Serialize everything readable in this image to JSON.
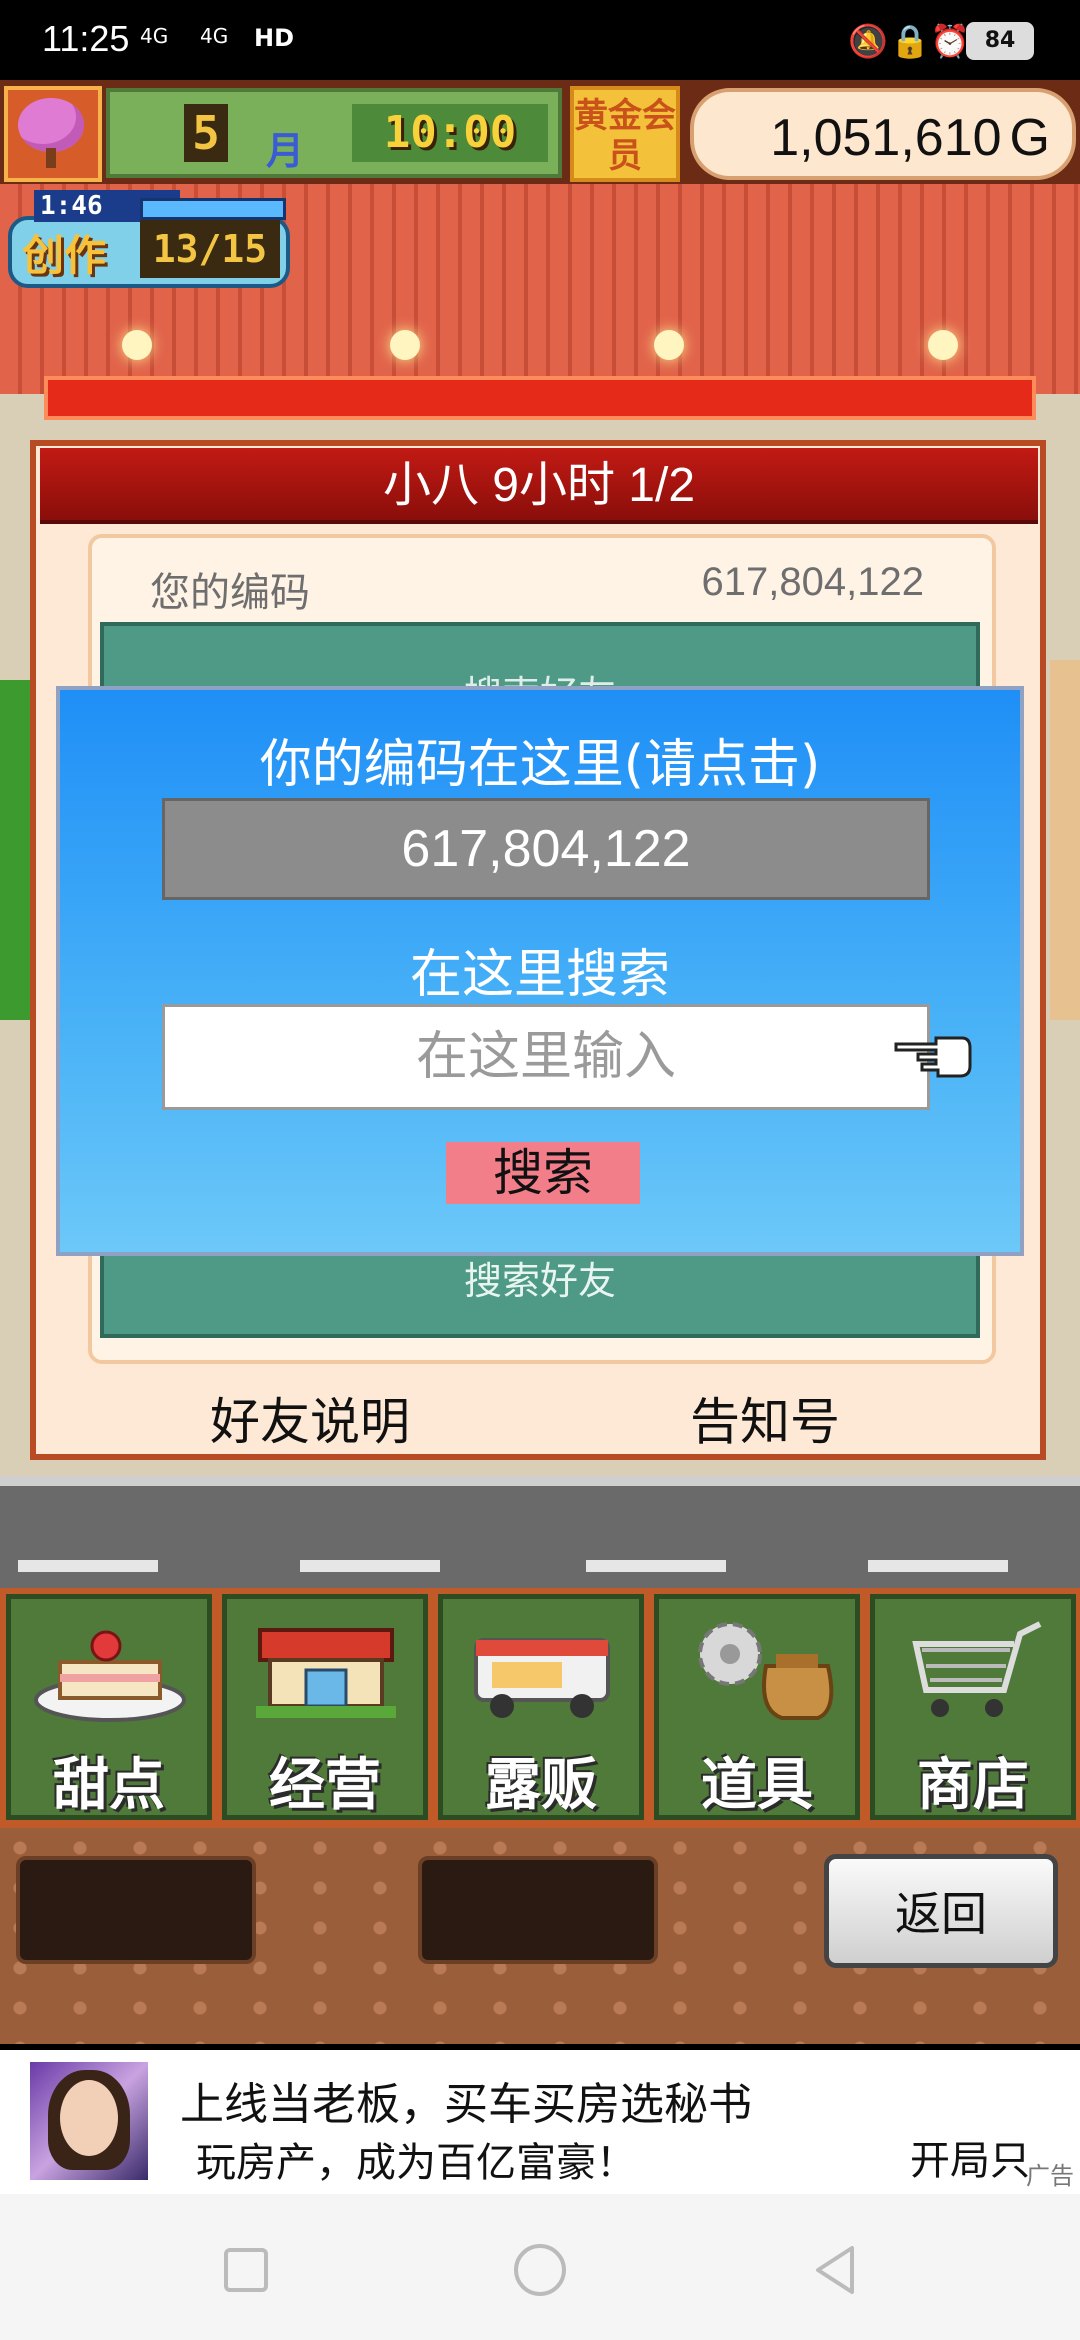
{
  "status_bar": {
    "time": "11:25",
    "signal_1": "4G",
    "signal_2": "4G",
    "hd": "HD",
    "battery": "84"
  },
  "hud": {
    "month_number": "5",
    "month_label": "月",
    "clock": "10:00",
    "gold_member": "黄金会员",
    "money": "1,051,610",
    "currency": "G"
  },
  "create_badge": {
    "timer": "1:46",
    "label": "创作",
    "count": "13/15"
  },
  "panel": {
    "title": "小八  9小时 1/2",
    "your_code_label": "您的编码",
    "your_code_value": "617,804,122",
    "search_friend_top": "搜索好友",
    "search_friend_bottom": "搜索好友",
    "friend_help": "好友说明",
    "notice": "告知号"
  },
  "dialog": {
    "title": "你的编码在这里(请点击)",
    "code": "617,804,122",
    "search_label": "在这里搜索",
    "input_placeholder": "在这里输入",
    "input_value": "",
    "search_button": "搜索"
  },
  "menu": [
    {
      "label": "甜点",
      "icon": "cake-icon"
    },
    {
      "label": "经营",
      "icon": "shop-icon"
    },
    {
      "label": "露贩",
      "icon": "food-truck-icon"
    },
    {
      "label": "道具",
      "icon": "gear-bag-icon"
    },
    {
      "label": "商店",
      "icon": "shopping-cart-icon"
    }
  ],
  "back_button": "返回",
  "ad": {
    "title": "上线当老板，买车买房选秘书",
    "subtitle": "玩房产，成为百亿富豪！",
    "cta": "开局只",
    "tag": "广告"
  },
  "colors": {
    "dialog_blue": "#1f8ff7",
    "panel_red": "#c21a14",
    "teal": "#4f9a86",
    "search_button": "#f27e8a"
  }
}
